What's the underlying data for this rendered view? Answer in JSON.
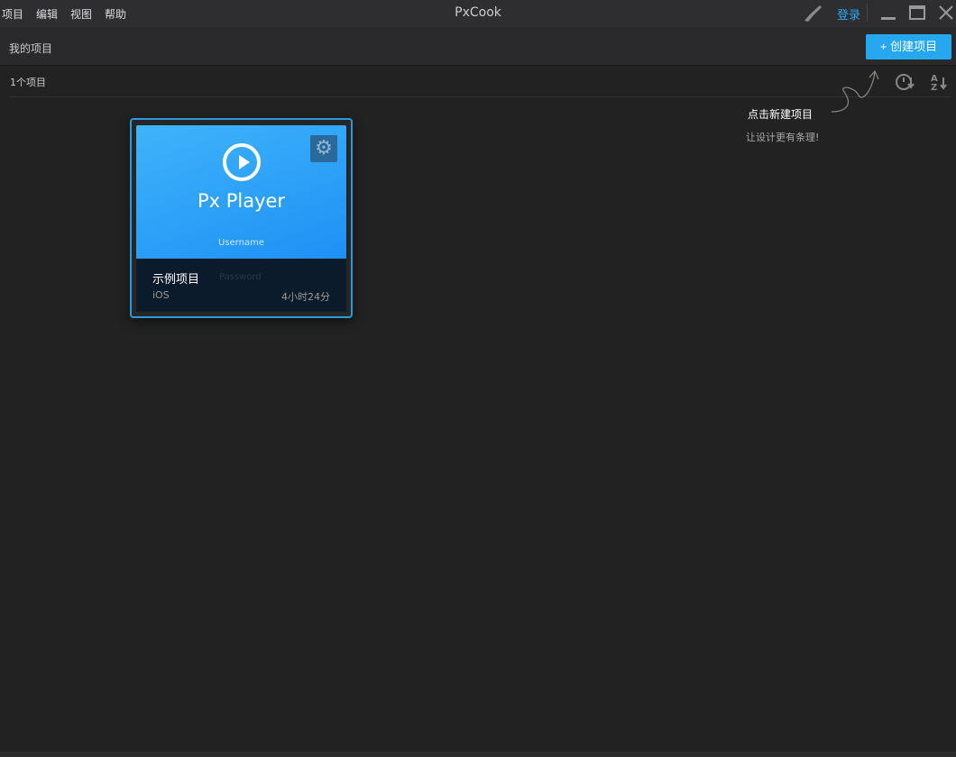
{
  "menu": [
    "项目",
    "编辑",
    "视图",
    "帮助"
  ],
  "app_title": "PxCook",
  "login": "登录",
  "header": {
    "title": "我的项目",
    "create_button": "+ 创建项目"
  },
  "count": "1个项目",
  "hint": {
    "title": "点击新建项目",
    "subtitle": "让设计更有条理!"
  },
  "project": {
    "thumb_title": "Px Player",
    "thumb_user": "Username",
    "thumb_password": "Password",
    "name": "示例项目",
    "platform": "iOS",
    "time": "4小时24分"
  },
  "colors": {
    "accent": "#25a8f0",
    "card_border": "#2a9ad8"
  }
}
